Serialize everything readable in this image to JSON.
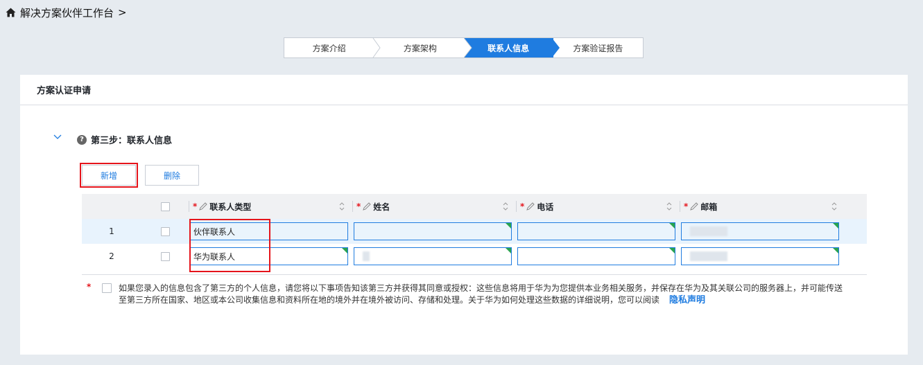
{
  "breadcrumb": {
    "icon": "home-icon",
    "title": "解决方案伙伴工作台",
    "separator": ">"
  },
  "steps": [
    {
      "label": "方案介绍",
      "active": false
    },
    {
      "label": "方案架构",
      "active": false
    },
    {
      "label": "联系人信息",
      "active": true
    },
    {
      "label": "方案验证报告",
      "active": false
    }
  ],
  "card": {
    "title": "方案认证申请",
    "section_title": "第三步：联系人信息",
    "add_label": "新增",
    "delete_label": "删除"
  },
  "table": {
    "columns": [
      {
        "label": "联系人类型",
        "required": true
      },
      {
        "label": "姓名",
        "required": true
      },
      {
        "label": "电话",
        "required": true
      },
      {
        "label": "邮箱",
        "required": true
      }
    ],
    "rows": [
      {
        "index": "1",
        "type": "伙伴联系人",
        "name": "",
        "phone": "",
        "email": ""
      },
      {
        "index": "2",
        "type": "华为联系人",
        "name": "",
        "phone": "",
        "email": ""
      }
    ]
  },
  "consent": {
    "text": "如果您录入的信息包含了第三方的个人信息，请您将以下事项告知该第三方并获得其同意或授权：这些信息将用于华为为您提供本业务相关服务，并保存在华为及其关联公司的服务器上，并可能传送至第三方所在国家、地区或本公司收集信息和资料所在地的境外并在境外被访问、存储和处理。关于华为如何处理这些数据的详细说明，您可以阅读",
    "link": "隐私声明",
    "required_mark": "*"
  },
  "colors": {
    "accent": "#1f7ce0",
    "required": "#e5141b",
    "valid_corner": "#2aa44f",
    "page_bg": "#e6ebf0"
  }
}
